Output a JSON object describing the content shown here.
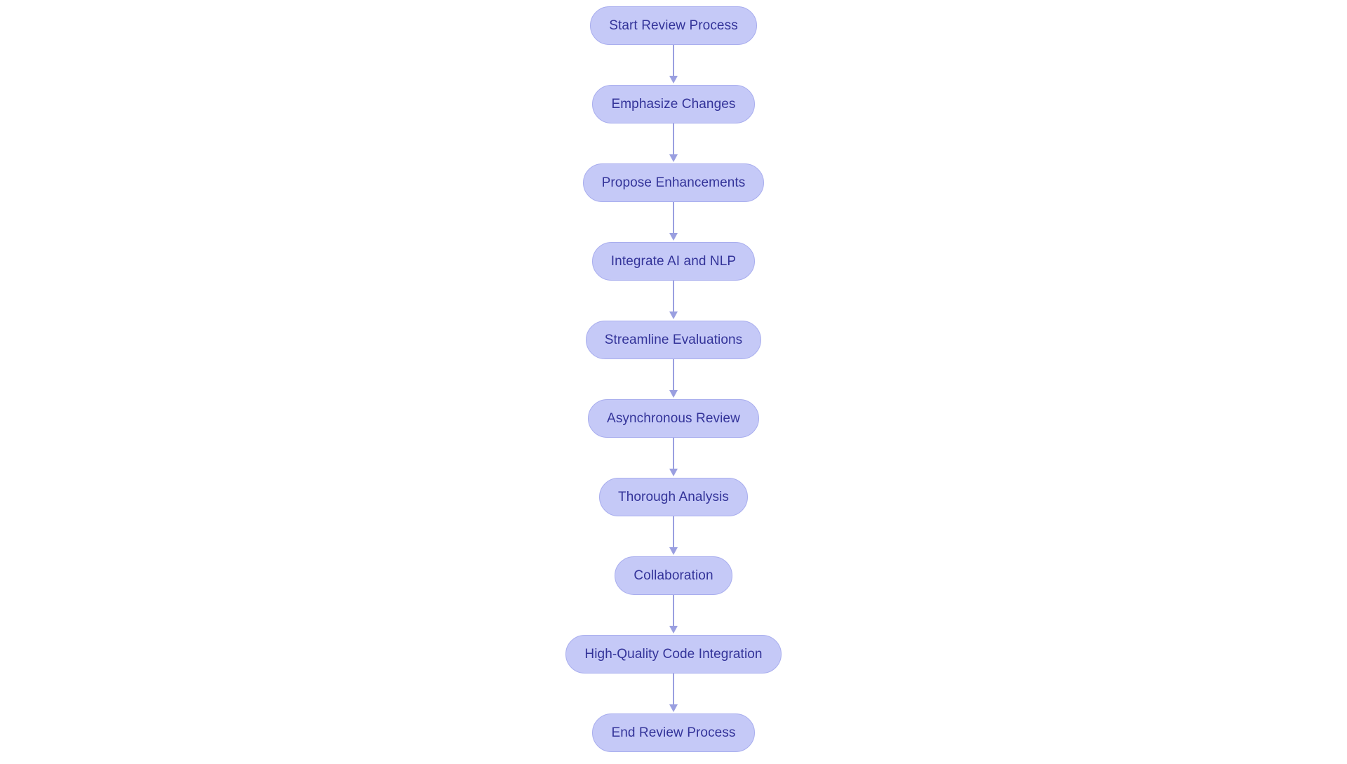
{
  "diagram": {
    "type": "flowchart",
    "orientation": "top-to-bottom",
    "background_color": "#ffffff",
    "node_fill_color": "#c5c9f7",
    "node_border_color": "#a9aeee",
    "node_text_color": "#333399",
    "connector_color": "#9a9fe0",
    "node_shape": "rounded-pill",
    "nodes": [
      {
        "id": "start-review-process",
        "label": "Start Review Process"
      },
      {
        "id": "emphasize-changes",
        "label": "Emphasize Changes"
      },
      {
        "id": "propose-enhancements",
        "label": "Propose Enhancements"
      },
      {
        "id": "integrate-ai-and-nlp",
        "label": "Integrate AI and NLP"
      },
      {
        "id": "streamline-evaluations",
        "label": "Streamline Evaluations"
      },
      {
        "id": "asynchronous-review",
        "label": "Asynchronous Review"
      },
      {
        "id": "thorough-analysis",
        "label": "Thorough Analysis"
      },
      {
        "id": "collaboration",
        "label": "Collaboration"
      },
      {
        "id": "high-quality-code-integration",
        "label": "High-Quality Code Integration"
      },
      {
        "id": "end-review-process",
        "label": "End Review Process"
      }
    ],
    "edges": [
      {
        "from": "start-review-process",
        "to": "emphasize-changes",
        "label": ""
      },
      {
        "from": "emphasize-changes",
        "to": "propose-enhancements",
        "label": ""
      },
      {
        "from": "propose-enhancements",
        "to": "integrate-ai-and-nlp",
        "label": ""
      },
      {
        "from": "integrate-ai-and-nlp",
        "to": "streamline-evaluations",
        "label": ""
      },
      {
        "from": "streamline-evaluations",
        "to": "asynchronous-review",
        "label": ""
      },
      {
        "from": "asynchronous-review",
        "to": "thorough-analysis",
        "label": ""
      },
      {
        "from": "thorough-analysis",
        "to": "collaboration",
        "label": ""
      },
      {
        "from": "collaboration",
        "to": "high-quality-code-integration",
        "label": ""
      },
      {
        "from": "high-quality-code-integration",
        "to": "end-review-process",
        "label": ""
      }
    ]
  }
}
